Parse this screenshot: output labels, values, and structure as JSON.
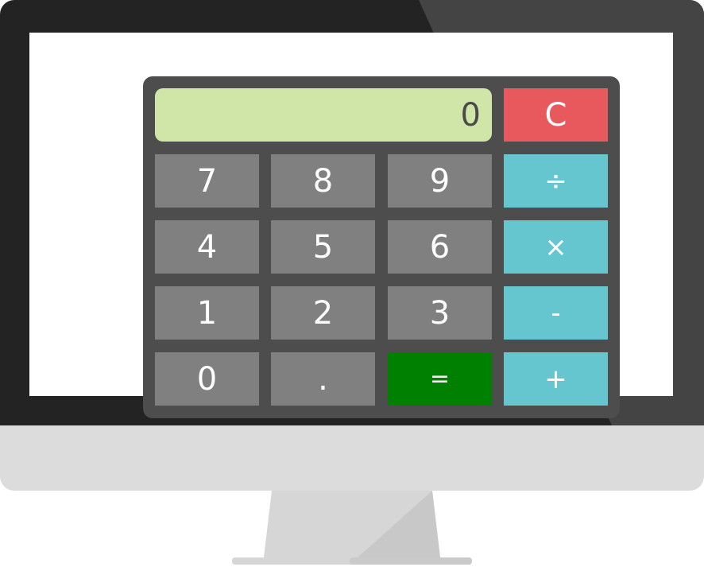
{
  "calculator": {
    "display_value": "0",
    "keys": {
      "clear": "C",
      "seven": "7",
      "eight": "8",
      "nine": "9",
      "divide": "÷",
      "four": "4",
      "five": "5",
      "six": "6",
      "multiply": "×",
      "one": "1",
      "two": "2",
      "three": "3",
      "subtract": "-",
      "zero": "0",
      "decimal": ".",
      "equals": "=",
      "add": "+"
    }
  },
  "colors": {
    "display_bg": "#d0e6a8",
    "number_key": "#808080",
    "operator_key": "#66c6d0",
    "clear_key": "#e8595e",
    "equals_key": "#008000",
    "calculator_body": "#4d4d4d",
    "bezel": "#232323",
    "chin": "#dcdcdc"
  }
}
